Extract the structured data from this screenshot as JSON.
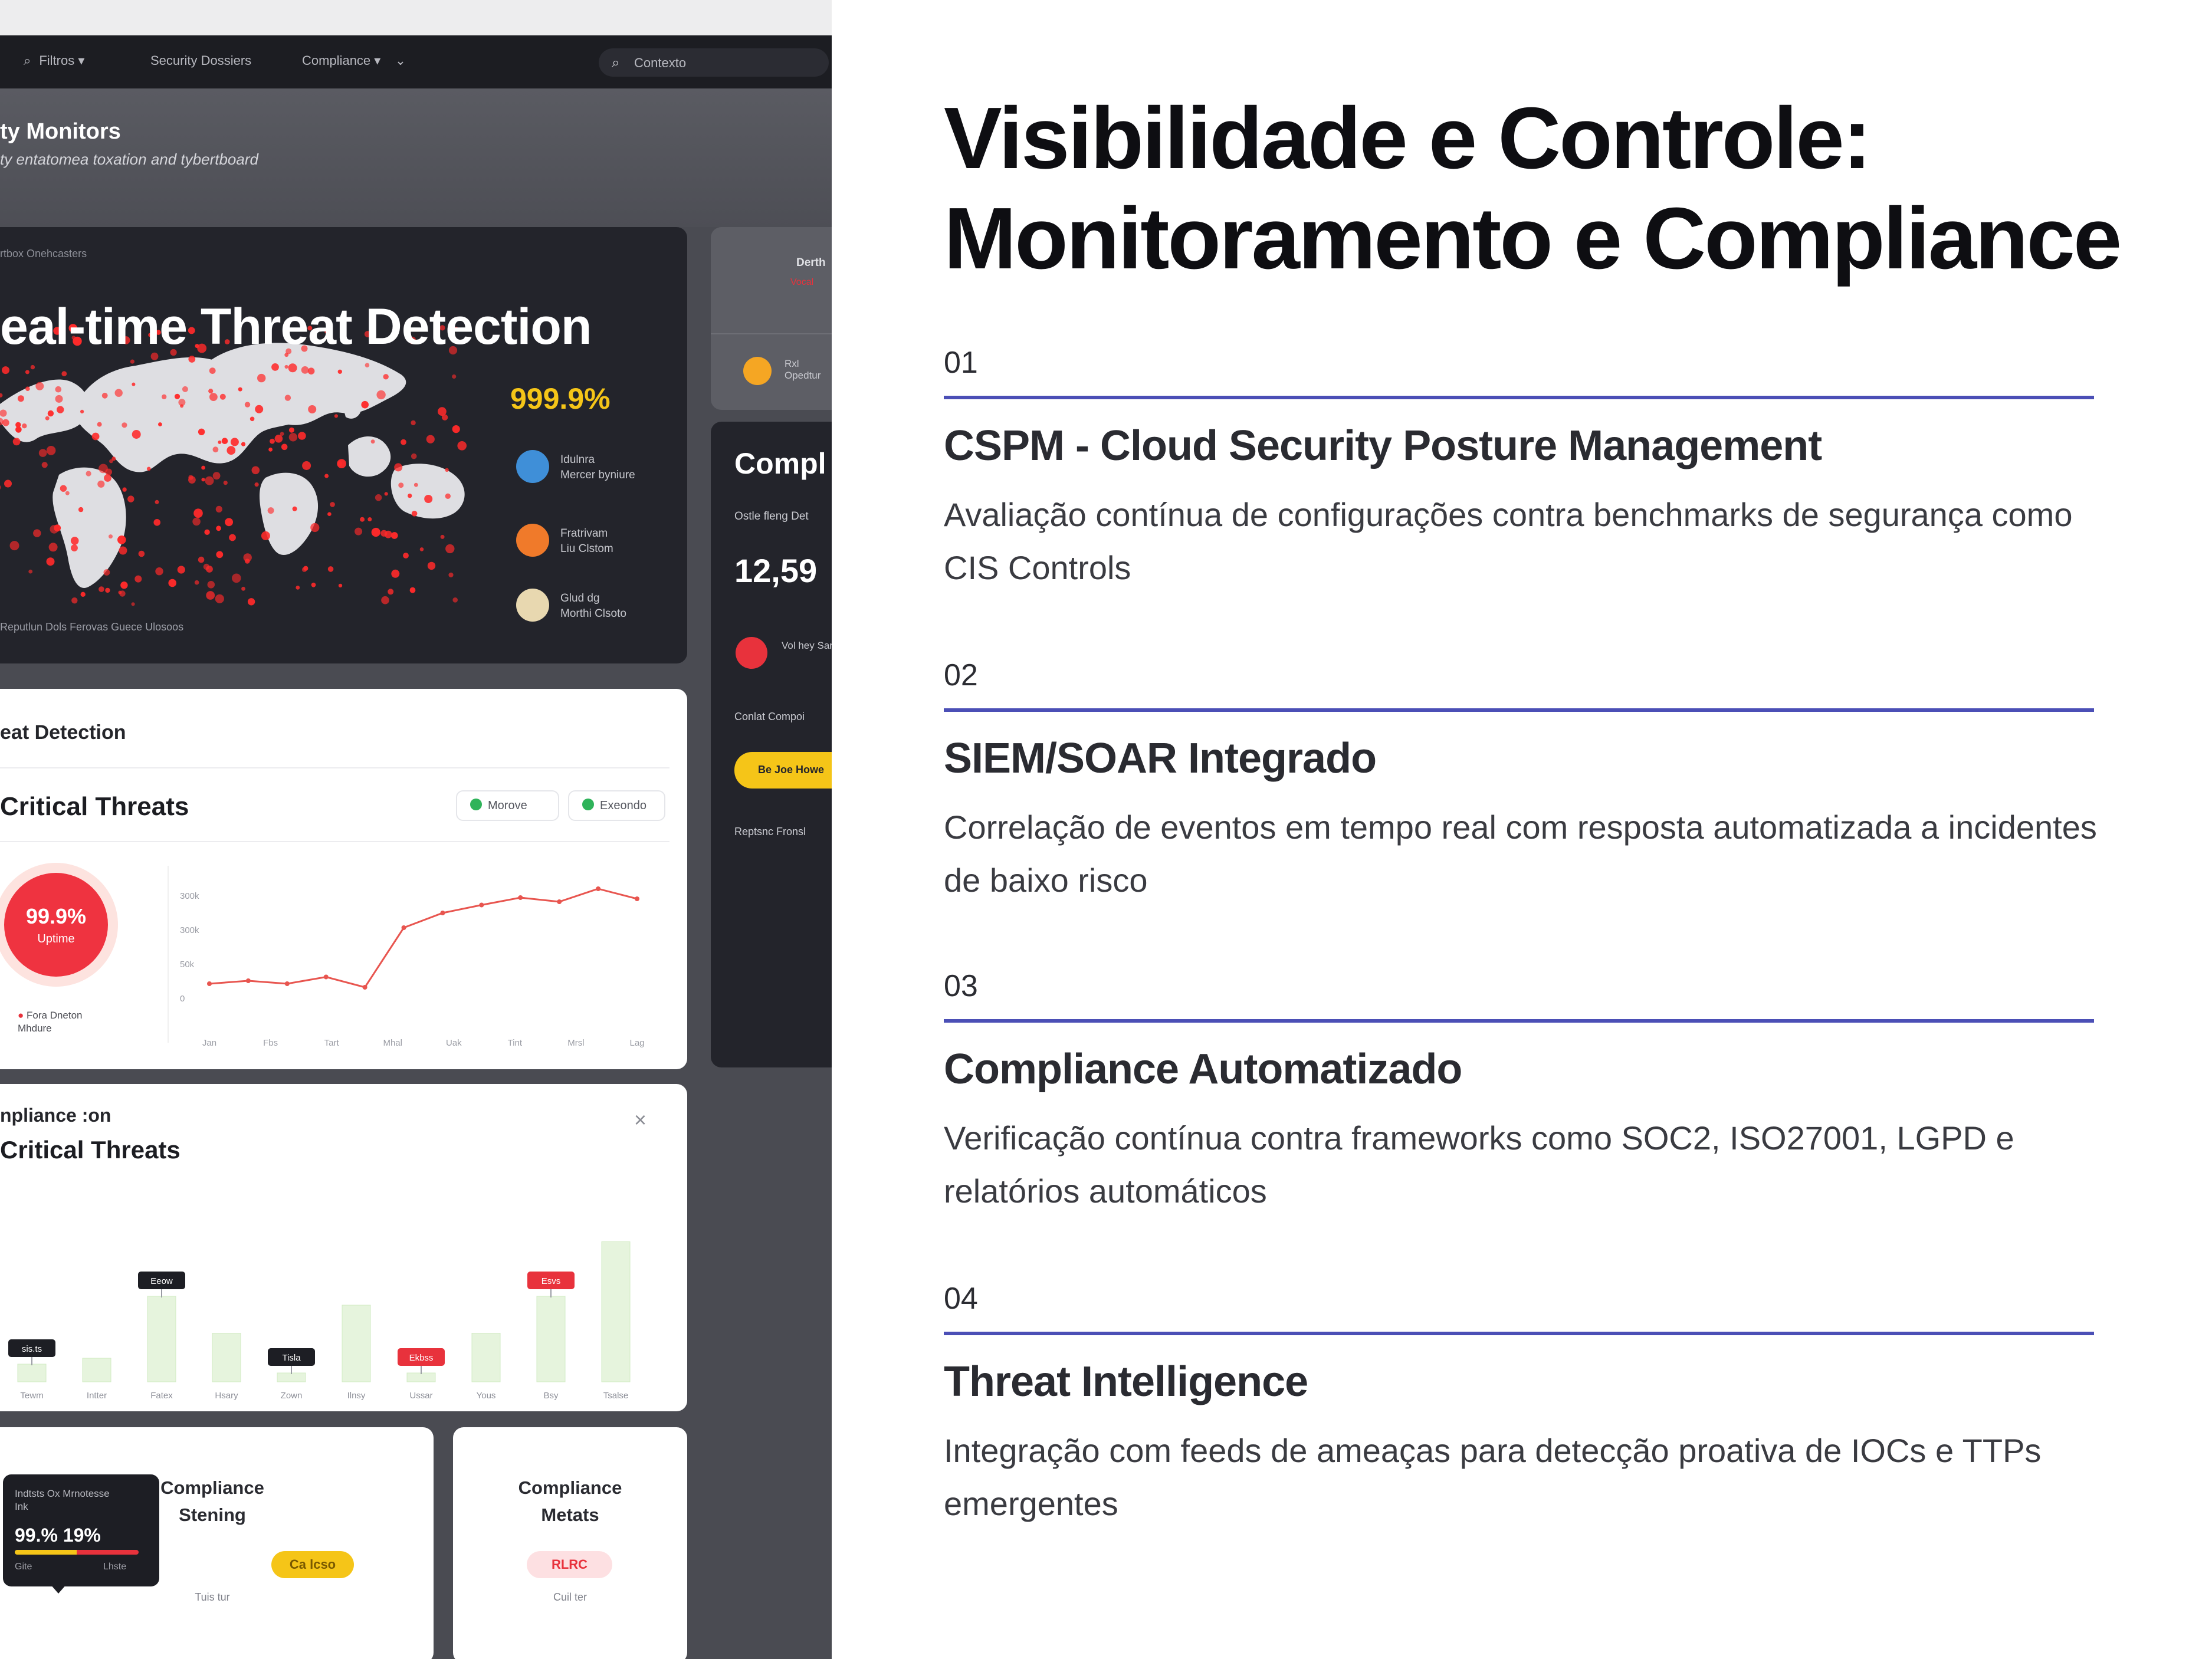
{
  "mockup": {
    "nav": {
      "items": [
        "Filtros",
        "Security Dossiers",
        "Compliance"
      ],
      "search_placeholder": "Contexto"
    },
    "header": {
      "title": "ty Monitors",
      "subtitle": "ty entatomea toxation and tybertboard"
    },
    "map_card": {
      "caption": "rtbox Onehcasters",
      "title": "eal-time Threat Detection",
      "percent": "999.9%",
      "users": [
        {
          "text": "Idulnra\nMercer byniure",
          "color": "#3f8fd8"
        },
        {
          "text": "Fratrivam\nLiu Clstom",
          "color": "#f07a2a"
        },
        {
          "text": "Glud dg\nMorthi Clsoto",
          "color": "#e8d8b0"
        }
      ],
      "legend": "Reputlun    Dols Ferovas      Guece   Ulosoos"
    },
    "side_card_a": {
      "title": "Derth",
      "tag": "Vocal",
      "item": "Rxl Opedtur"
    },
    "side_card_b": {
      "title": "Compl",
      "caption": "Ostle fleng Det",
      "value": "12,59",
      "item": "Vol hey Sarin",
      "caption2": "Conlat Compoi",
      "button": "Be Joe Howe",
      "caption3": "Reptsnc Fronsl"
    },
    "threat_card": {
      "label": "eat Detection",
      "title": "Critical Threats",
      "chips": [
        {
          "label": "Morove",
          "color": "#2fb35a"
        },
        {
          "label": "Exeondo",
          "color": "#2fb35a"
        }
      ],
      "donut_value": "99.9%",
      "donut_label": "Uptime",
      "donut_legend": "Fora Dneton\nMhdure",
      "y_ticks": [
        "300k",
        "300k",
        "50k",
        "0"
      ],
      "x_ticks": [
        "Jan",
        "Fbs",
        "Tart",
        "Mhal",
        "Uak",
        "Tint",
        "Mrsl",
        "Lag"
      ],
      "line_values": [
        160,
        170,
        160,
        183,
        148,
        350,
        400,
        427,
        452,
        438,
        482,
        448
      ]
    },
    "bar_card": {
      "label": "npliance :on",
      "title": "Critical Threats",
      "close": "×",
      "categories": [
        "Tewm",
        "Intter",
        "Fatex",
        "Hsary",
        "Zown",
        "Ilnsy",
        "Ussar",
        "Yous",
        "Bsy",
        "Tsalse"
      ],
      "values": [
        0.12,
        0.16,
        0.58,
        0.33,
        0.06,
        0.52,
        0.06,
        0.33,
        0.58,
        0.95
      ],
      "tags": [
        {
          "index": 0,
          "text": "sis.ts",
          "color": "#1d1e24"
        },
        {
          "index": 2,
          "text": "Eeow",
          "color": "#1d1e24"
        },
        {
          "index": 4,
          "text": "Tisla",
          "color": "#1d1e24"
        },
        {
          "index": 6,
          "text": "Ekbss",
          "color": "#e8323c"
        },
        {
          "index": 8,
          "text": "Esvs",
          "color": "#e8323c"
        }
      ]
    },
    "bottom_cards": [
      {
        "tooltip_head": "Indtsts Ox Mrnotesse\nInk",
        "tooltip_value": "99.% 19%",
        "tooltip_left": "Gite",
        "tooltip_right": "Lhste",
        "title": "Compliance\nStening",
        "badge": "Ca lcso",
        "badge_color": "#f5c518",
        "foot": "Tuis tur"
      },
      {
        "title": "Compliance\nMetats",
        "badge": "RLRC",
        "badge_color": "#fde0e2",
        "foot": "Cuil ter"
      }
    ]
  },
  "content": {
    "title_line1": "Visibilidade e Controle:",
    "title_line2": "Monitoramento e Compliance",
    "accent_color": "#4b4fb6",
    "features": [
      {
        "num": "01",
        "title": "CSPM - Cloud Security Posture Management",
        "desc": "Avaliação contínua de configurações contra benchmarks de segurança como CIS Controls"
      },
      {
        "num": "02",
        "title": "SIEM/SOAR Integrado",
        "desc": "Correlação de eventos em tempo real com resposta automatizada a incidentes de baixo risco"
      },
      {
        "num": "03",
        "title": "Compliance Automatizado",
        "desc": "Verificação contínua contra frameworks como SOC2, ISO27001, LGPD e relatórios automáticos"
      },
      {
        "num": "04",
        "title": "Threat Intelligence",
        "desc": "Integração com feeds de ameaças para detecção proativa de IOCs e TTPs emergentes"
      }
    ]
  }
}
